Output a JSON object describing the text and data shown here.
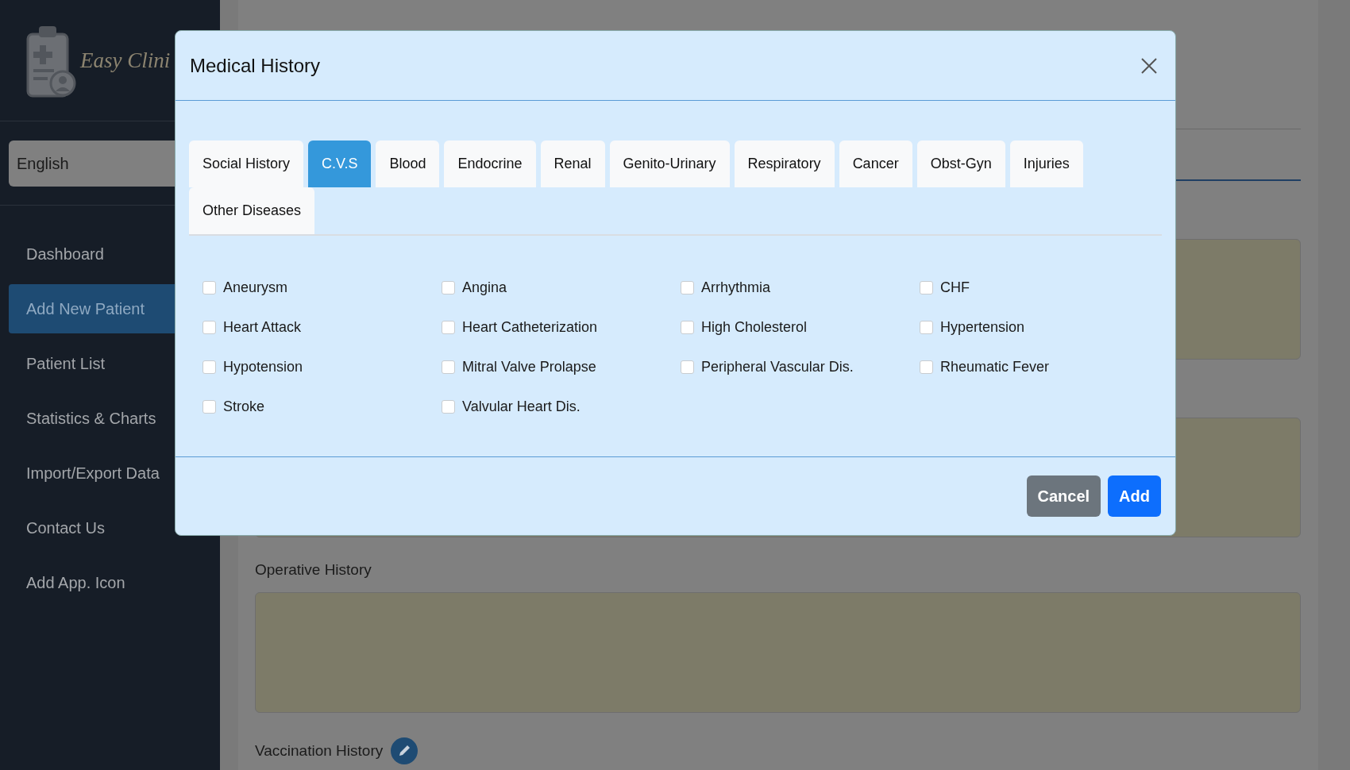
{
  "sidebar": {
    "logo_text": "Easy Clini",
    "language": "English",
    "items": [
      {
        "label": "Dashboard",
        "selected": false
      },
      {
        "label": "Add New Patient",
        "selected": true
      },
      {
        "label": "Patient List",
        "selected": false
      },
      {
        "label": "Statistics & Charts",
        "selected": false
      },
      {
        "label": "Import/Export Data",
        "selected": false
      },
      {
        "label": "Contact Us",
        "selected": false
      },
      {
        "label": "Add App. Icon",
        "selected": false
      }
    ]
  },
  "page": {
    "operative_label": "Operative History",
    "vaccination_label": "Vaccination History"
  },
  "modal": {
    "title": "Medical History",
    "tabs": [
      {
        "label": "Social History",
        "selected": false
      },
      {
        "label": "C.V.S",
        "selected": true
      },
      {
        "label": "Blood",
        "selected": false
      },
      {
        "label": "Endocrine",
        "selected": false
      },
      {
        "label": "Renal",
        "selected": false
      },
      {
        "label": "Genito-Urinary",
        "selected": false
      },
      {
        "label": "Respiratory",
        "selected": false
      },
      {
        "label": "Cancer",
        "selected": false
      },
      {
        "label": "Obst-Gyn",
        "selected": false
      },
      {
        "label": "Injuries",
        "selected": false
      },
      {
        "label": "Other Diseases",
        "selected": false
      }
    ],
    "conditions": [
      {
        "label": "Aneurysm",
        "checked": false
      },
      {
        "label": "Angina",
        "checked": false
      },
      {
        "label": "Arrhythmia",
        "checked": false
      },
      {
        "label": "CHF",
        "checked": false
      },
      {
        "label": "Heart Attack",
        "checked": false
      },
      {
        "label": "Heart Catheterization",
        "checked": false
      },
      {
        "label": "High Cholesterol",
        "checked": false
      },
      {
        "label": "Hypertension",
        "checked": false
      },
      {
        "label": "Hypotension",
        "checked": false
      },
      {
        "label": "Mitral Valve Prolapse",
        "checked": false
      },
      {
        "label": "Peripheral Vascular Dis.",
        "checked": false
      },
      {
        "label": "Rheumatic Fever",
        "checked": false
      },
      {
        "label": "Stroke",
        "checked": false
      },
      {
        "label": "Valvular Heart Dis.",
        "checked": false
      }
    ],
    "buttons": [
      {
        "label": "Cancel",
        "kind": "secondary"
      },
      {
        "label": "Add",
        "kind": "primary"
      }
    ]
  }
}
